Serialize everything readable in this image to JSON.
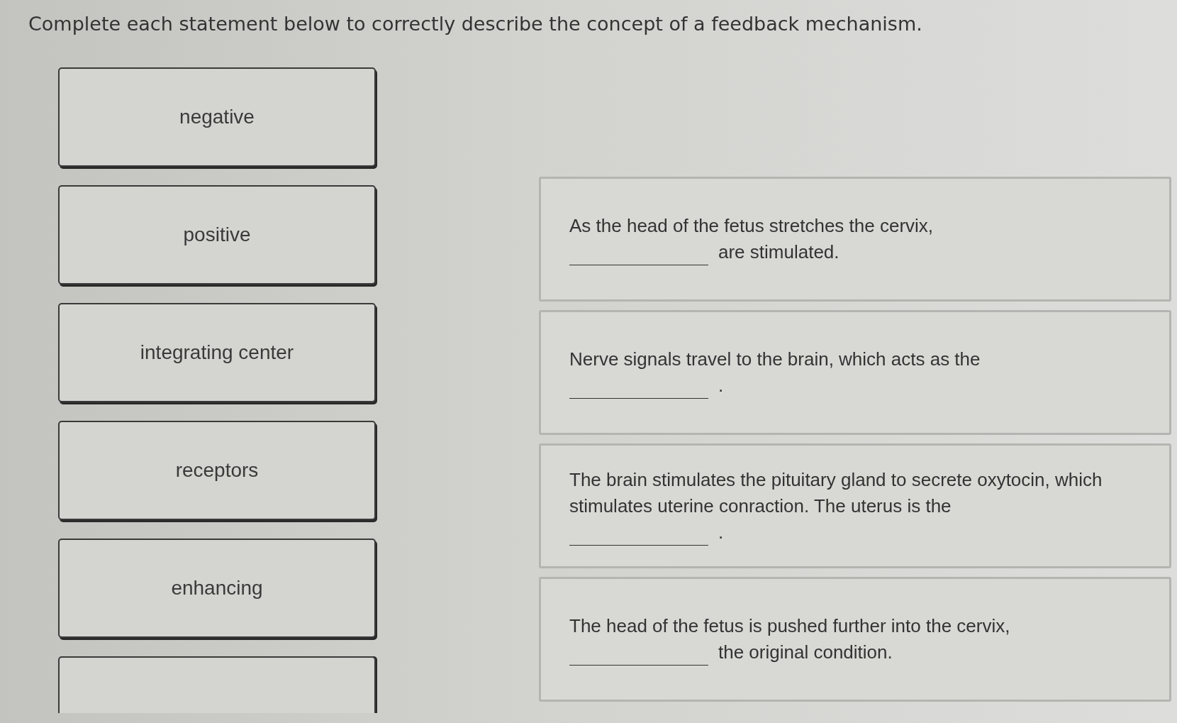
{
  "instruction": "Complete each statement below to correctly describe the concept of a feedback mechanism.",
  "choices": [
    {
      "label": "negative"
    },
    {
      "label": "positive"
    },
    {
      "label": "integrating center"
    },
    {
      "label": "receptors"
    },
    {
      "label": "enhancing"
    }
  ],
  "more_choices_below": true,
  "statements": [
    {
      "text_before": "As the head of the fetus stretches the cervix,",
      "text_after": "are stimulated."
    },
    {
      "text_before": "Nerve signals travel to the brain, which acts as the",
      "text_after": "."
    },
    {
      "text_before": "The brain stimulates the pituitary gland to secrete oxytocin, which stimulates uterine conraction. The uterus is the",
      "text_after": "."
    },
    {
      "text_before": "The head of the fetus is pushed further into the cervix,",
      "text_after": "the original condition."
    }
  ]
}
